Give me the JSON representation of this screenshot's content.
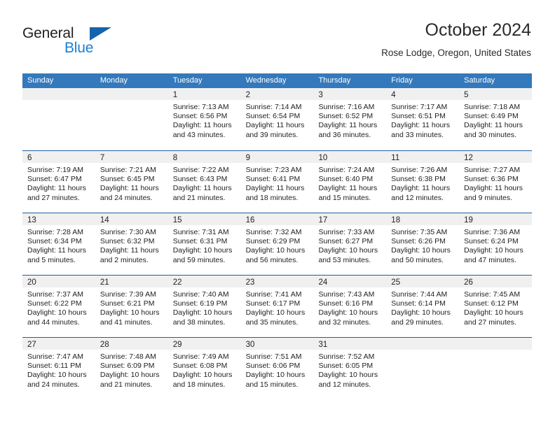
{
  "brand": {
    "name_top": "General",
    "name_bottom": "Blue",
    "accent_color": "#1b7fd4",
    "triangle_color": "#1464ac"
  },
  "header": {
    "title": "October 2024",
    "subtitle": "Rose Lodge, Oregon, United States"
  },
  "calendar": {
    "header_bg": "#3479bb",
    "daynum_bg": "#f0f0f0",
    "weekday_labels": [
      "Sunday",
      "Monday",
      "Tuesday",
      "Wednesday",
      "Thursday",
      "Friday",
      "Saturday"
    ],
    "weeks": [
      [
        {
          "day": "",
          "sunrise": "",
          "sunset": "",
          "daylight_line1": "",
          "daylight_line2": ""
        },
        {
          "day": "",
          "sunrise": "",
          "sunset": "",
          "daylight_line1": "",
          "daylight_line2": ""
        },
        {
          "day": "1",
          "sunrise": "Sunrise: 7:13 AM",
          "sunset": "Sunset: 6:56 PM",
          "daylight_line1": "Daylight: 11 hours",
          "daylight_line2": "and 43 minutes."
        },
        {
          "day": "2",
          "sunrise": "Sunrise: 7:14 AM",
          "sunset": "Sunset: 6:54 PM",
          "daylight_line1": "Daylight: 11 hours",
          "daylight_line2": "and 39 minutes."
        },
        {
          "day": "3",
          "sunrise": "Sunrise: 7:16 AM",
          "sunset": "Sunset: 6:52 PM",
          "daylight_line1": "Daylight: 11 hours",
          "daylight_line2": "and 36 minutes."
        },
        {
          "day": "4",
          "sunrise": "Sunrise: 7:17 AM",
          "sunset": "Sunset: 6:51 PM",
          "daylight_line1": "Daylight: 11 hours",
          "daylight_line2": "and 33 minutes."
        },
        {
          "day": "5",
          "sunrise": "Sunrise: 7:18 AM",
          "sunset": "Sunset: 6:49 PM",
          "daylight_line1": "Daylight: 11 hours",
          "daylight_line2": "and 30 minutes."
        }
      ],
      [
        {
          "day": "6",
          "sunrise": "Sunrise: 7:19 AM",
          "sunset": "Sunset: 6:47 PM",
          "daylight_line1": "Daylight: 11 hours",
          "daylight_line2": "and 27 minutes."
        },
        {
          "day": "7",
          "sunrise": "Sunrise: 7:21 AM",
          "sunset": "Sunset: 6:45 PM",
          "daylight_line1": "Daylight: 11 hours",
          "daylight_line2": "and 24 minutes."
        },
        {
          "day": "8",
          "sunrise": "Sunrise: 7:22 AM",
          "sunset": "Sunset: 6:43 PM",
          "daylight_line1": "Daylight: 11 hours",
          "daylight_line2": "and 21 minutes."
        },
        {
          "day": "9",
          "sunrise": "Sunrise: 7:23 AM",
          "sunset": "Sunset: 6:41 PM",
          "daylight_line1": "Daylight: 11 hours",
          "daylight_line2": "and 18 minutes."
        },
        {
          "day": "10",
          "sunrise": "Sunrise: 7:24 AM",
          "sunset": "Sunset: 6:40 PM",
          "daylight_line1": "Daylight: 11 hours",
          "daylight_line2": "and 15 minutes."
        },
        {
          "day": "11",
          "sunrise": "Sunrise: 7:26 AM",
          "sunset": "Sunset: 6:38 PM",
          "daylight_line1": "Daylight: 11 hours",
          "daylight_line2": "and 12 minutes."
        },
        {
          "day": "12",
          "sunrise": "Sunrise: 7:27 AM",
          "sunset": "Sunset: 6:36 PM",
          "daylight_line1": "Daylight: 11 hours",
          "daylight_line2": "and 9 minutes."
        }
      ],
      [
        {
          "day": "13",
          "sunrise": "Sunrise: 7:28 AM",
          "sunset": "Sunset: 6:34 PM",
          "daylight_line1": "Daylight: 11 hours",
          "daylight_line2": "and 5 minutes."
        },
        {
          "day": "14",
          "sunrise": "Sunrise: 7:30 AM",
          "sunset": "Sunset: 6:32 PM",
          "daylight_line1": "Daylight: 11 hours",
          "daylight_line2": "and 2 minutes."
        },
        {
          "day": "15",
          "sunrise": "Sunrise: 7:31 AM",
          "sunset": "Sunset: 6:31 PM",
          "daylight_line1": "Daylight: 10 hours",
          "daylight_line2": "and 59 minutes."
        },
        {
          "day": "16",
          "sunrise": "Sunrise: 7:32 AM",
          "sunset": "Sunset: 6:29 PM",
          "daylight_line1": "Daylight: 10 hours",
          "daylight_line2": "and 56 minutes."
        },
        {
          "day": "17",
          "sunrise": "Sunrise: 7:33 AM",
          "sunset": "Sunset: 6:27 PM",
          "daylight_line1": "Daylight: 10 hours",
          "daylight_line2": "and 53 minutes."
        },
        {
          "day": "18",
          "sunrise": "Sunrise: 7:35 AM",
          "sunset": "Sunset: 6:26 PM",
          "daylight_line1": "Daylight: 10 hours",
          "daylight_line2": "and 50 minutes."
        },
        {
          "day": "19",
          "sunrise": "Sunrise: 7:36 AM",
          "sunset": "Sunset: 6:24 PM",
          "daylight_line1": "Daylight: 10 hours",
          "daylight_line2": "and 47 minutes."
        }
      ],
      [
        {
          "day": "20",
          "sunrise": "Sunrise: 7:37 AM",
          "sunset": "Sunset: 6:22 PM",
          "daylight_line1": "Daylight: 10 hours",
          "daylight_line2": "and 44 minutes."
        },
        {
          "day": "21",
          "sunrise": "Sunrise: 7:39 AM",
          "sunset": "Sunset: 6:21 PM",
          "daylight_line1": "Daylight: 10 hours",
          "daylight_line2": "and 41 minutes."
        },
        {
          "day": "22",
          "sunrise": "Sunrise: 7:40 AM",
          "sunset": "Sunset: 6:19 PM",
          "daylight_line1": "Daylight: 10 hours",
          "daylight_line2": "and 38 minutes."
        },
        {
          "day": "23",
          "sunrise": "Sunrise: 7:41 AM",
          "sunset": "Sunset: 6:17 PM",
          "daylight_line1": "Daylight: 10 hours",
          "daylight_line2": "and 35 minutes."
        },
        {
          "day": "24",
          "sunrise": "Sunrise: 7:43 AM",
          "sunset": "Sunset: 6:16 PM",
          "daylight_line1": "Daylight: 10 hours",
          "daylight_line2": "and 32 minutes."
        },
        {
          "day": "25",
          "sunrise": "Sunrise: 7:44 AM",
          "sunset": "Sunset: 6:14 PM",
          "daylight_line1": "Daylight: 10 hours",
          "daylight_line2": "and 29 minutes."
        },
        {
          "day": "26",
          "sunrise": "Sunrise: 7:45 AM",
          "sunset": "Sunset: 6:12 PM",
          "daylight_line1": "Daylight: 10 hours",
          "daylight_line2": "and 27 minutes."
        }
      ],
      [
        {
          "day": "27",
          "sunrise": "Sunrise: 7:47 AM",
          "sunset": "Sunset: 6:11 PM",
          "daylight_line1": "Daylight: 10 hours",
          "daylight_line2": "and 24 minutes."
        },
        {
          "day": "28",
          "sunrise": "Sunrise: 7:48 AM",
          "sunset": "Sunset: 6:09 PM",
          "daylight_line1": "Daylight: 10 hours",
          "daylight_line2": "and 21 minutes."
        },
        {
          "day": "29",
          "sunrise": "Sunrise: 7:49 AM",
          "sunset": "Sunset: 6:08 PM",
          "daylight_line1": "Daylight: 10 hours",
          "daylight_line2": "and 18 minutes."
        },
        {
          "day": "30",
          "sunrise": "Sunrise: 7:51 AM",
          "sunset": "Sunset: 6:06 PM",
          "daylight_line1": "Daylight: 10 hours",
          "daylight_line2": "and 15 minutes."
        },
        {
          "day": "31",
          "sunrise": "Sunrise: 7:52 AM",
          "sunset": "Sunset: 6:05 PM",
          "daylight_line1": "Daylight: 10 hours",
          "daylight_line2": "and 12 minutes."
        },
        {
          "day": "",
          "sunrise": "",
          "sunset": "",
          "daylight_line1": "",
          "daylight_line2": ""
        },
        {
          "day": "",
          "sunrise": "",
          "sunset": "",
          "daylight_line1": "",
          "daylight_line2": ""
        }
      ]
    ]
  }
}
